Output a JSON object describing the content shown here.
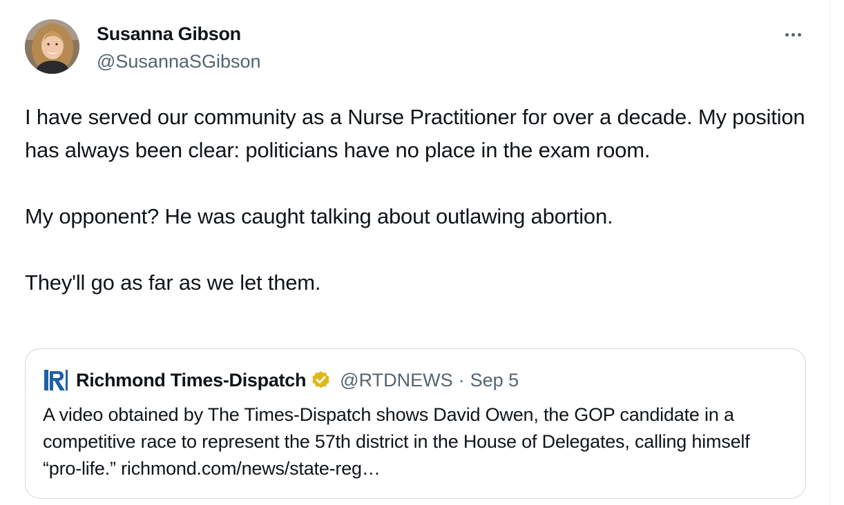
{
  "author": {
    "display_name": "Susanna Gibson",
    "handle": "@SusannaSGibson",
    "avatar": "profile-photo"
  },
  "more_icon": "more-horizontal-icon",
  "tweet": {
    "text": "I have served our community as a Nurse Practitioner for over a decade. My position has always been clear: politicians have no place in the exam room.\n\nMy opponent? He was caught talking about outlawing abortion.\n\nThey'll go as far as we let them."
  },
  "quote": {
    "logo_icon": "richmond-times-dispatch-logo-icon",
    "name": "Richmond Times-Dispatch",
    "verified_icon": "gold-verified-badge-icon",
    "handle": "@RTDNEWS",
    "separator": "·",
    "date": "Sep 5",
    "text": "A video obtained by The Times-Dispatch shows David Owen, the GOP candidate in a competitive race to represent the 57th district in the House of Delegates, calling himself “pro-life.” richmond.com/news/state-reg…"
  },
  "colors": {
    "text_primary": "#0f1419",
    "text_secondary": "#536471",
    "border": "#cfd9de",
    "verified_gold": "#e2b719",
    "logo_blue": "#1d5fa8"
  }
}
